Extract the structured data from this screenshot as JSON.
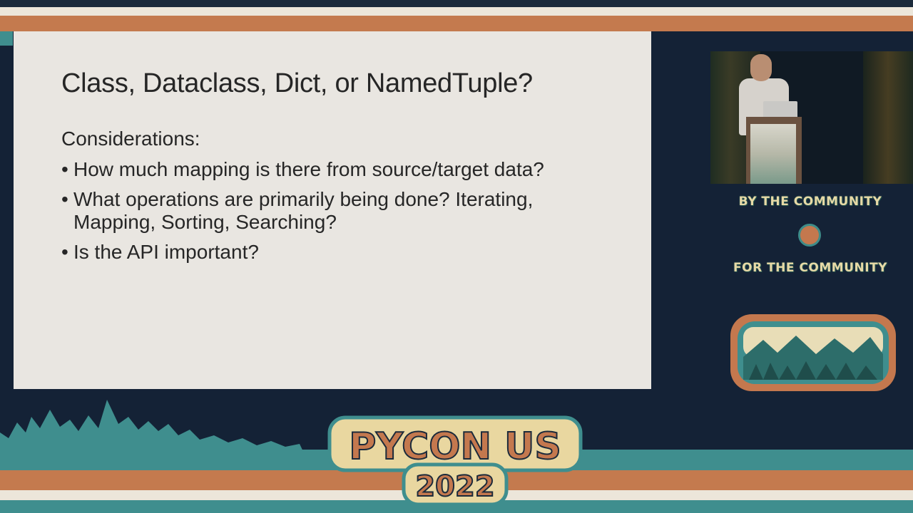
{
  "slide": {
    "title": "Class, Dataclass, Dict, or NamedTuple?",
    "subheading": "Considerations:",
    "bullets": [
      {
        "line1": "How much mapping is there from source/target data?",
        "line2": ""
      },
      {
        "line1": "What operations are primarily being done? Iterating,",
        "line2": "Mapping, Sorting, Searching?"
      },
      {
        "line1": "Is the API important?",
        "line2": ""
      }
    ],
    "bullet_glyph": "•"
  },
  "sidebar": {
    "tagline_top": "BY THE COMMUNITY",
    "tagline_bottom": "FOR THE COMMUNITY"
  },
  "branding": {
    "event_name": "PYCON US",
    "event_year": "2022"
  },
  "colors": {
    "background": "#142236",
    "slide": "#e9e6e1",
    "orange": "#c47a4e",
    "teal": "#3f8e8e",
    "cream": "#e7d9a6"
  }
}
